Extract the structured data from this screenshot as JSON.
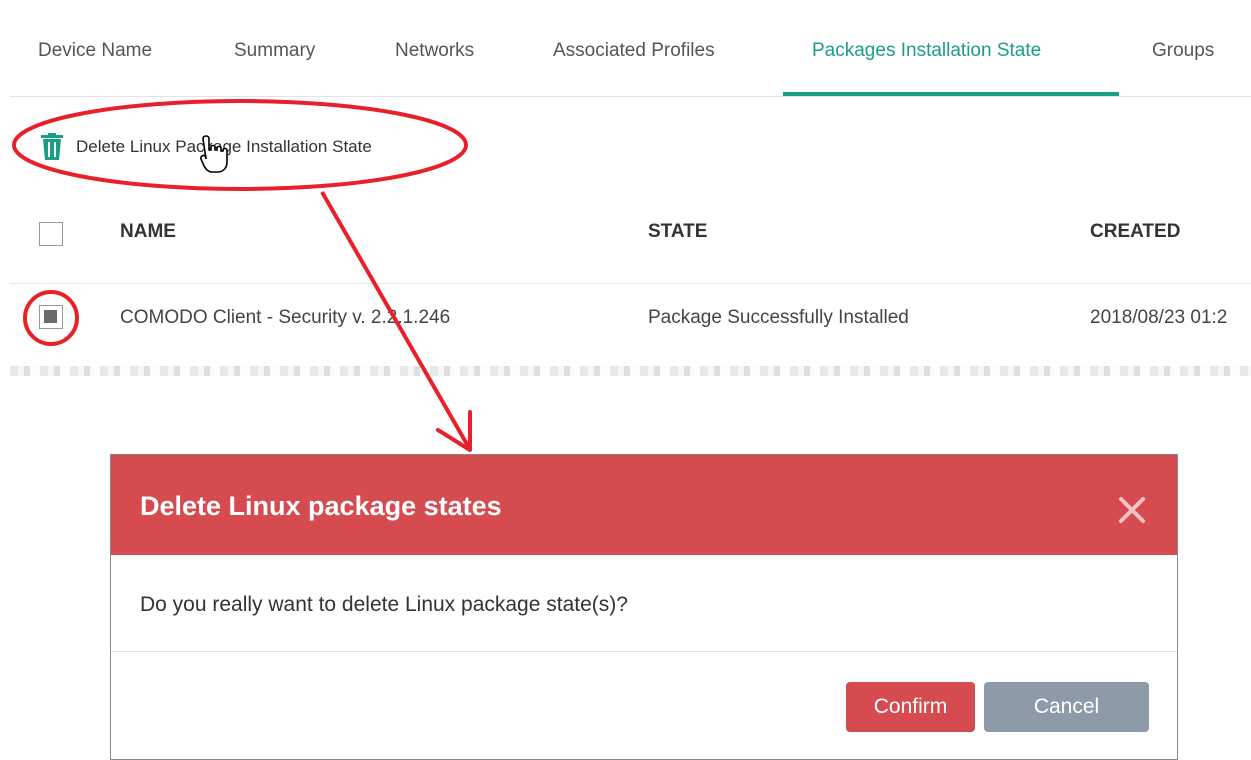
{
  "tabs": [
    {
      "label": "Device Name"
    },
    {
      "label": "Summary"
    },
    {
      "label": "Networks"
    },
    {
      "label": "Associated Profiles"
    },
    {
      "label": "Packages Installation State",
      "active": true
    },
    {
      "label": "Groups"
    }
  ],
  "toolbar": {
    "delete_label": "Delete Linux Package Installation State",
    "delete_icon": "trash-icon"
  },
  "table": {
    "columns": [
      "NAME",
      "STATE",
      "CREATED"
    ],
    "rows": [
      {
        "checked": true,
        "name": "COMODO Client - Security v. 2.2.1.246",
        "state": "Package Successfully Installed",
        "created": "2018/08/23 01:2"
      }
    ]
  },
  "dialog": {
    "title": "Delete Linux package states",
    "message": "Do you really want to delete Linux package state(s)?",
    "confirm_label": "Confirm",
    "cancel_label": "Cancel",
    "close_icon": "close-icon"
  },
  "colors": {
    "accent_teal": "#1a9e85",
    "dialog_red": "#d54b4f",
    "cancel_gray": "#8d9ba8",
    "annotation_red": "#e8202a"
  }
}
